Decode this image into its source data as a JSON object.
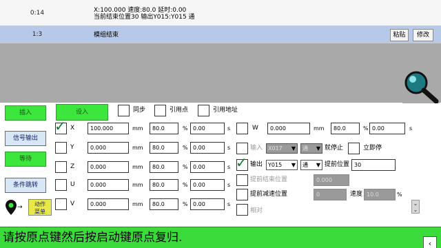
{
  "program": {
    "rows": [
      {
        "num": "0:14",
        "line1": "X:100.000 速度:80.0 延时:0.00",
        "line2": "当前结束位置30 输出Y015:Y015 通"
      },
      {
        "num": "1:3",
        "line1": "模组结束",
        "line2": ""
      }
    ],
    "paste_label": "粘贴",
    "modify_label": "修改"
  },
  "icons": {
    "search": "search-icon",
    "location": "location-pin-icon",
    "back": "chevron-left-icon",
    "scroll": "double-chevron-down-icon"
  },
  "left_buttons": {
    "insert": "插入",
    "signal_output": "信号输出",
    "wait": "等待",
    "conditional_jump": "条件跳转",
    "action_menu_line1": "动作",
    "action_menu_line2": "菜单"
  },
  "top_bar": {
    "set_label": "设入",
    "sync_label": "同步",
    "ref_point_label": "引用点",
    "ref_address_label": "引用地址"
  },
  "axes": [
    {
      "name": "X",
      "checked": true,
      "pos": "100.000",
      "pos_unit": "mm",
      "speed": "80.0",
      "speed_unit": "%",
      "delay": "0.00",
      "delay_unit": "s"
    },
    {
      "name": "Y",
      "checked": false,
      "pos": "0.000",
      "pos_unit": "mm",
      "speed": "80.0",
      "speed_unit": "%",
      "delay": "0.00",
      "delay_unit": "s"
    },
    {
      "name": "Z",
      "checked": false,
      "pos": "0.000",
      "pos_unit": "mm",
      "speed": "80.0",
      "speed_unit": "%",
      "delay": "0.00",
      "delay_unit": "s"
    },
    {
      "name": "U",
      "checked": false,
      "pos": "0.000",
      "pos_unit": "mm",
      "speed": "80.0",
      "speed_unit": "%",
      "delay": "0.00",
      "delay_unit": "s"
    },
    {
      "name": "V",
      "checked": false,
      "pos": "0.000",
      "pos_unit": "mm",
      "speed": "80.0",
      "speed_unit": "%",
      "delay": "0.00",
      "delay_unit": "s"
    }
  ],
  "w_axis": {
    "name": "W",
    "checked": false,
    "pos": "0.000",
    "pos_unit": "mm",
    "speed": "80.0",
    "speed_unit": "%",
    "delay": "0.00",
    "delay_unit": "s"
  },
  "input_row": {
    "label": "输入",
    "select": "X017",
    "mode": "通",
    "stop_label": "就停止",
    "stop_now_label": "立即停"
  },
  "output_row": {
    "label": "输出",
    "checked": true,
    "select": "Y015",
    "mode": "通",
    "early_pos_label": "提前位置",
    "early_pos_value": "30"
  },
  "early_end": {
    "label": "提前结束位置",
    "value": "0.000"
  },
  "early_decel": {
    "label": "提前减速位置",
    "value": "0",
    "speed_label": "速度",
    "speed_value": "10.0",
    "speed_unit": "%"
  },
  "relative": {
    "label": "相对"
  },
  "status": {
    "message": "请按原点键然后按启动键原点复归."
  },
  "colors": {
    "accent_green": "#3ce63c",
    "status_green": "#3cdb3c",
    "row_blue": "#b6c9e8",
    "gray_area": "#a9a9a9"
  }
}
